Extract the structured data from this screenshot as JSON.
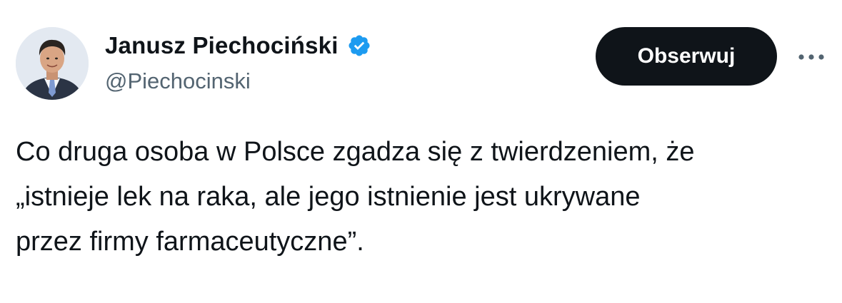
{
  "author": {
    "display_name": "Janusz Piechociński",
    "handle": "@Piechocinski",
    "verified": true,
    "verified_icon": "verified-badge-icon",
    "verified_color": "#1d9bf0",
    "avatar_icon": "avatar-photo"
  },
  "actions": {
    "follow_label": "Obserwuj",
    "more_icon": "more-options-icon",
    "follow_bg": "#0f1419",
    "follow_text_color": "#ffffff"
  },
  "tweet": {
    "lines": [
      "Co druga osoba w Polsce zgadza się z twierdzeniem, że",
      "„istnieje lek na raka, ale jego istnienie jest ukrywane",
      "przez firmy farmaceutyczne”."
    ]
  }
}
